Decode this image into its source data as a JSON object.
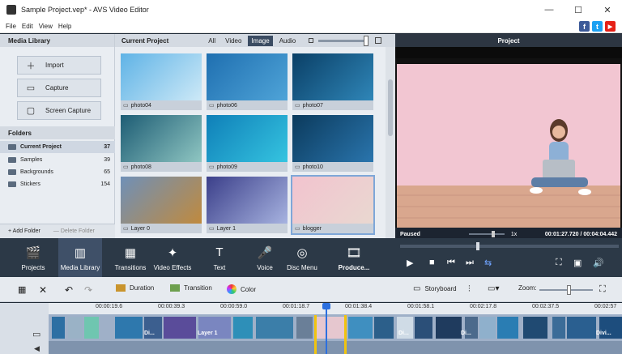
{
  "window": {
    "title": "Sample Project.vep* - AVS Video Editor",
    "minimize": "—",
    "maximize": "☐",
    "close": "✕"
  },
  "menu": [
    "File",
    "Edit",
    "View",
    "Help"
  ],
  "social": {
    "facebook": "f",
    "twitter": "t",
    "youtube": "▶"
  },
  "media_library": {
    "header": "Media Library",
    "buttons": {
      "import": "Import",
      "capture": "Capture",
      "screen_capture": "Screen Capture"
    },
    "icons": {
      "import": "plus-icon",
      "capture": "camera-icon",
      "screen_capture": "monitor-icon"
    },
    "folders_header": "Folders",
    "folders": [
      {
        "name": "Current Project",
        "count": "37",
        "selected": true
      },
      {
        "name": "Samples",
        "count": "39"
      },
      {
        "name": "Backgrounds",
        "count": "65"
      },
      {
        "name": "Stickers",
        "count": "154"
      }
    ],
    "add_folder": "+ Add Folder",
    "delete_folder": "— Delete Folder"
  },
  "current_project": {
    "header": "Current Project",
    "tabs": [
      "All",
      "Video",
      "Image",
      "Audio"
    ],
    "active_tab": "Image",
    "items": [
      {
        "label": "photo04",
        "colors": [
          "#5fb3e6",
          "#cde9f7"
        ]
      },
      {
        "label": "photo06",
        "colors": [
          "#1f6fb0",
          "#4fa4d8"
        ]
      },
      {
        "label": "photo07",
        "colors": [
          "#0a3f66",
          "#2f86b8"
        ]
      },
      {
        "label": "photo08",
        "colors": [
          "#1d5c74",
          "#8fc6c2"
        ]
      },
      {
        "label": "photo09",
        "colors": [
          "#0f7fb8",
          "#35c4e0"
        ]
      },
      {
        "label": "photo10",
        "colors": [
          "#0b3a5c",
          "#2a75ad"
        ]
      },
      {
        "label": "Layer 0",
        "colors": [
          "#6f90b8",
          "#c08a3e"
        ]
      },
      {
        "label": "Layer 1",
        "colors": [
          "#3b3f8a",
          "#a7b3e0"
        ]
      },
      {
        "label": "blogger",
        "colors": [
          "#f2c3cf",
          "#e9d8d0"
        ]
      }
    ]
  },
  "project": {
    "header": "Project",
    "status": "Paused",
    "speed": "1x",
    "time": "00:01:27.720 / 00:04:04.442"
  },
  "toolbar": {
    "items": [
      {
        "label": "Projects",
        "icon": "clapperboard-icon"
      },
      {
        "label": "Media Library",
        "icon": "media-library-icon"
      },
      {
        "label": "Transitions",
        "icon": "transitions-icon"
      },
      {
        "label": "Video Effects",
        "icon": "video-effects-icon"
      },
      {
        "label": "Text",
        "icon": "text-icon"
      },
      {
        "label": "Voice",
        "icon": "microphone-icon"
      },
      {
        "label": "Disc Menu",
        "icon": "disc-menu-icon"
      },
      {
        "label": "Produce...",
        "icon": "produce-icon"
      }
    ],
    "active": "Media Library"
  },
  "timeline_controls": {
    "duration": "Duration",
    "transition": "Transition",
    "color": "Color",
    "storyboard": "Storyboard",
    "zoom": "Zoom:"
  },
  "timeline": {
    "ticks": [
      "00:00:19.6",
      "00:00:39.3",
      "00:00:59.0",
      "00:01:18.7",
      "00:01:38.4",
      "00:01:58.1",
      "00:02:17.8",
      "00:02:37.5",
      "00:02:57"
    ],
    "clip_labels": [
      "Di...",
      "Layer 1",
      "Di...",
      "Di...",
      "Divi..."
    ]
  }
}
